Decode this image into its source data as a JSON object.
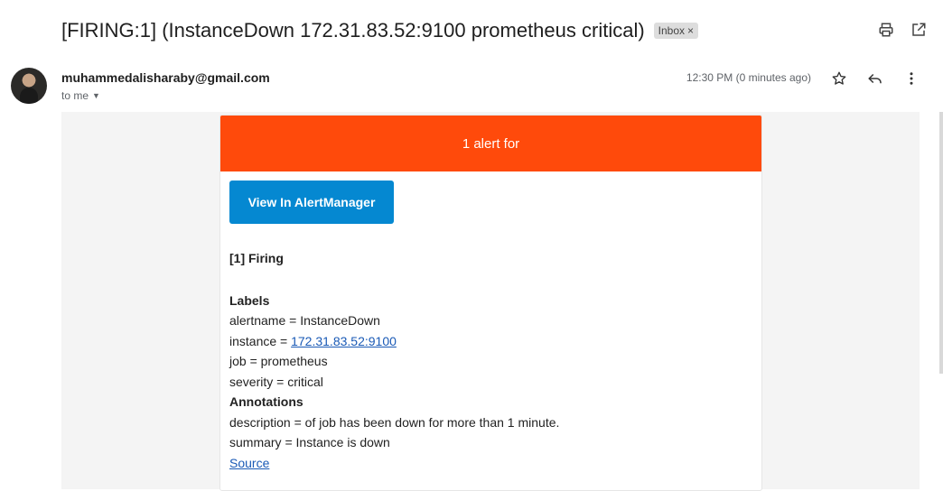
{
  "subject": {
    "title": "[FIRING:1] (InstanceDown 172.31.83.52:9100 prometheus critical)",
    "label_chip": "Inbox",
    "label_close": "×"
  },
  "header_actions": [
    "print-icon",
    "open-in-new-window-icon"
  ],
  "message": {
    "sender": "muhammedalisharaby@gmail.com",
    "recipient": "to me",
    "time": "12:30 PM (0 minutes ago)",
    "actions": [
      "star-icon",
      "reply-icon",
      "more-vert-icon"
    ]
  },
  "alert": {
    "banner": "1 alert for",
    "button": "View In AlertManager",
    "firing": "[1] Firing",
    "labels_title": "Labels",
    "labels": {
      "alertname": "alertname = InstanceDown",
      "instance_prefix": "instance = ",
      "instance_link": "172.31.83.52:9100",
      "job": "job = prometheus",
      "severity": "severity = critical"
    },
    "annotations_title": "Annotations",
    "annotations": {
      "description": "description = of job has been down for more than 1 minute.",
      "summary": "summary = Instance is down"
    },
    "source_link": "Source"
  },
  "colors": {
    "banner": "#ff4a0b",
    "button": "#0588d1",
    "link": "#1a5ab6"
  }
}
